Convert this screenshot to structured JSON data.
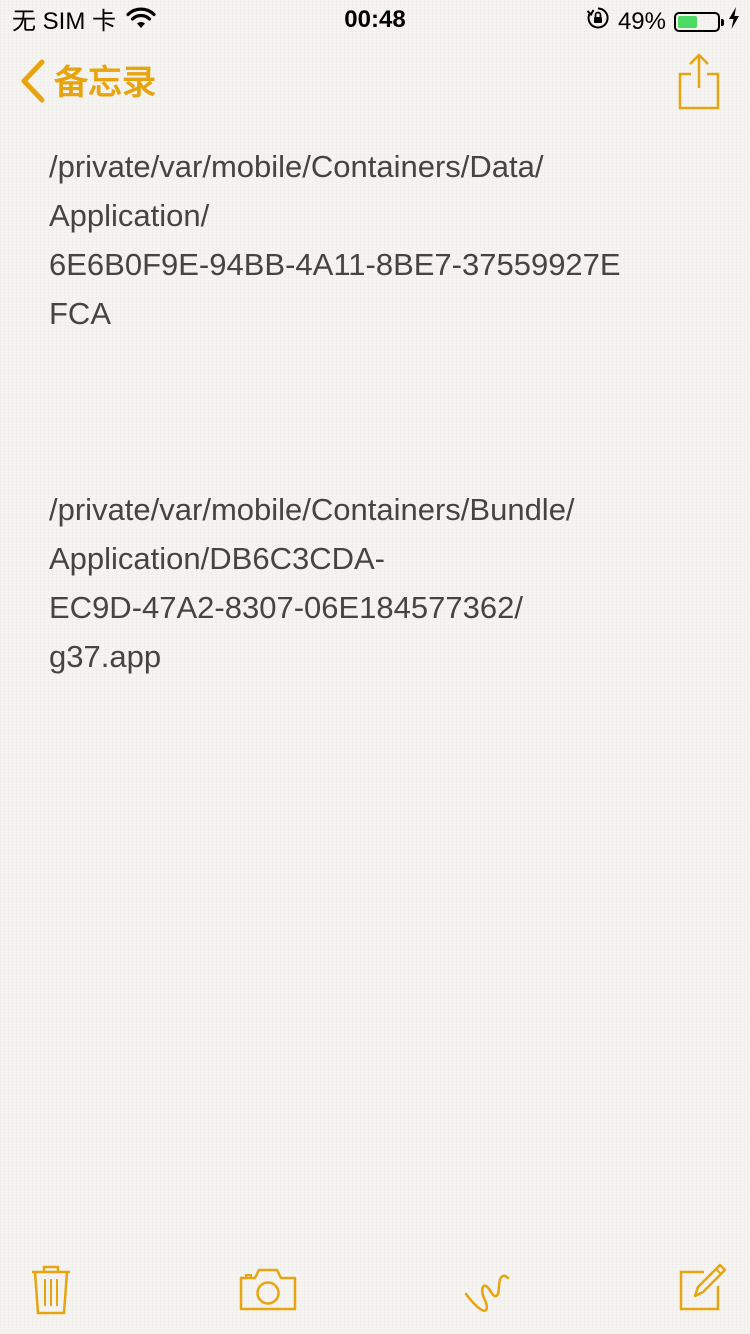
{
  "status_bar": {
    "carrier": "无 SIM 卡",
    "time": "00:48",
    "battery_percent": "49%",
    "battery_level": 0.49,
    "icons": [
      "wifi-icon",
      "orientation-lock-icon",
      "battery-icon",
      "charging-bolt-icon"
    ]
  },
  "nav": {
    "back_label": "备忘录",
    "back_icon": "chevron-left-icon",
    "share_icon": "share-icon"
  },
  "note": {
    "paragraphs": [
      {
        "lines": [
          "/private/var/mobile/Containers/Data/",
          "Application/",
          "6E6B0F9E-94BB-4A11-8BE7-37559927E",
          "FCA"
        ]
      },
      {
        "lines": [
          "/private/var/mobile/Containers/Bundle/",
          "Application/DB6C3CDA-",
          "EC9D-47A2-8307-06E184577362/",
          "g37.app"
        ]
      }
    ]
  },
  "toolbar": {
    "icons": [
      "trash-icon",
      "camera-icon",
      "sketch-icon",
      "compose-icon"
    ]
  },
  "colors": {
    "accent": "#e8a40e",
    "text": "#444444",
    "background": "#f5f4f1",
    "battery_fill": "#4cd964"
  }
}
